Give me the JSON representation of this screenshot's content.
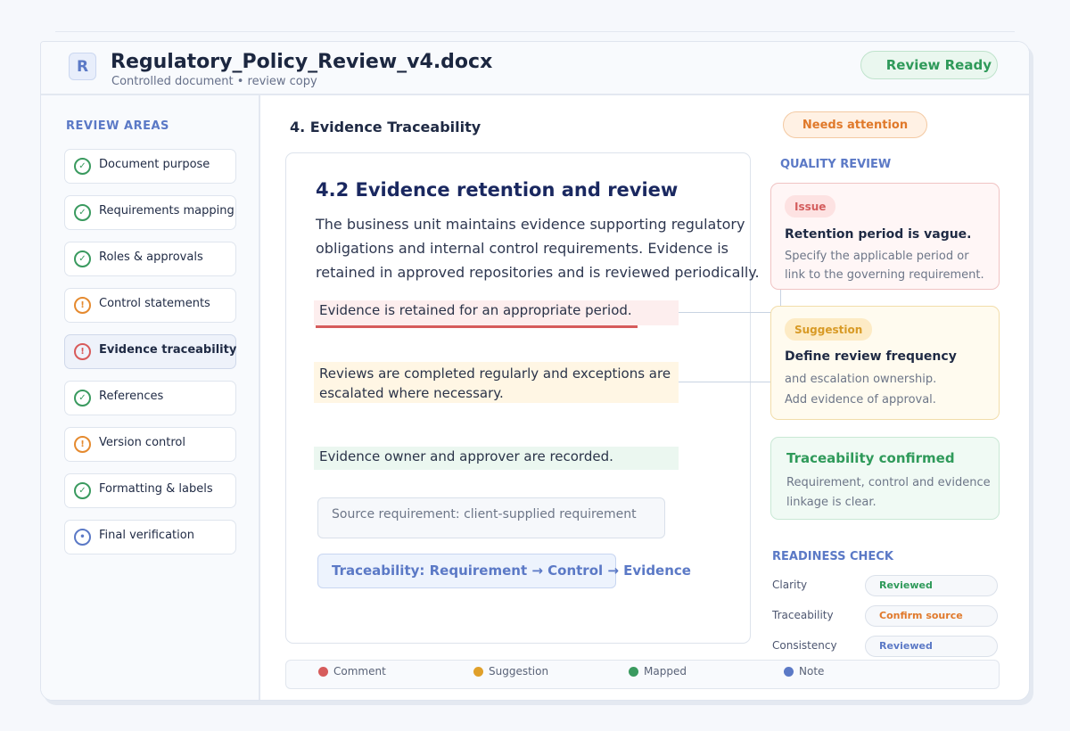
{
  "app": {
    "logo_letter": "R",
    "title": "Regulatory_Policy_Review_v4.docx",
    "subtitle": "Controlled document • review copy",
    "status": "Review Ready"
  },
  "sidebar": {
    "heading": "REVIEW AREAS",
    "items": [
      {
        "label": "Document purpose",
        "status": "complete",
        "icon": "check-circle-icon",
        "glyph": "✓"
      },
      {
        "label": "Requirements mapping",
        "status": "complete",
        "icon": "check-circle-icon",
        "glyph": "✓"
      },
      {
        "label": "Roles & approvals",
        "status": "complete",
        "icon": "check-circle-icon",
        "glyph": "✓"
      },
      {
        "label": "Control statements",
        "status": "warning",
        "icon": "alert-circle-icon",
        "glyph": "!"
      },
      {
        "label": "Evidence traceability",
        "status": "issue",
        "icon": "alert-circle-icon",
        "glyph": "!",
        "active": true
      },
      {
        "label": "References",
        "status": "complete",
        "icon": "check-circle-icon",
        "glyph": "✓"
      },
      {
        "label": "Version control",
        "status": "warning",
        "icon": "alert-circle-icon",
        "glyph": "!"
      },
      {
        "label": "Formatting & labels",
        "status": "complete",
        "icon": "check-circle-icon",
        "glyph": "✓"
      },
      {
        "label": "Final verification",
        "status": "info",
        "icon": "info-circle-icon",
        "glyph": "•"
      }
    ]
  },
  "main": {
    "section_title": "4. Evidence Traceability",
    "attention_badge": "Needs attention",
    "doc": {
      "heading": "4.2 Evidence retention and review",
      "paragraph": "The business unit maintains evidence supporting regulatory obligations and internal control requirements. Evidence is retained in approved repositories and is reviewed periodically.",
      "highlight_comment": "Evidence is retained for an appropriate period.",
      "highlight_suggestion": "Reviews are completed regularly and exceptions are escalated where necessary.",
      "highlight_mapped": "Evidence owner and approver are recorded.",
      "source_box": "Source requirement: client-supplied requirement",
      "traceability_box": "Traceability: Requirement → Control → Evidence"
    }
  },
  "quality_review": {
    "heading": "QUALITY REVIEW",
    "issue": {
      "tag": "Issue",
      "title": "Retention period is vague.",
      "body": "Specify the applicable period or link to the governing requirement."
    },
    "suggestion": {
      "tag": "Suggestion",
      "title": "Define review frequency",
      "body_line1": "and escalation ownership.",
      "body_line2": "Add evidence of approval."
    },
    "confirmed": {
      "title": "Traceability confirmed",
      "body": "Requirement, control and evidence linkage is clear."
    }
  },
  "readiness": {
    "heading": "READINESS CHECK",
    "rows": [
      {
        "label": "Clarity",
        "value": "Reviewed",
        "color": "#2f9a5a"
      },
      {
        "label": "Traceability",
        "value": "Confirm source",
        "color": "#e0792a"
      },
      {
        "label": "Consistency",
        "value": "Reviewed",
        "color": "#5b79c6"
      }
    ]
  },
  "legend": [
    {
      "label": "Comment",
      "color": "#d65c5c"
    },
    {
      "label": "Suggestion",
      "color": "#e0a02a"
    },
    {
      "label": "Mapped",
      "color": "#3a9a5f"
    },
    {
      "label": "Note",
      "color": "#5b79c6"
    }
  ]
}
